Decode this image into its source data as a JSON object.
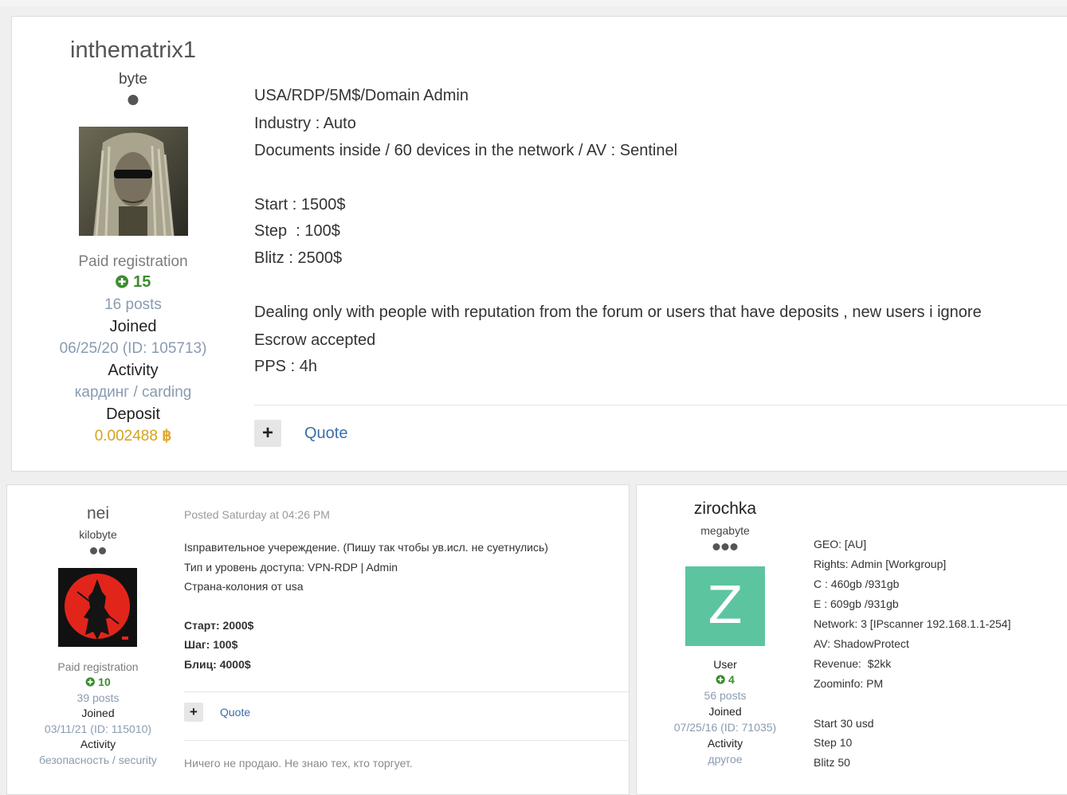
{
  "post1": {
    "author": {
      "username": "inthematrix1",
      "rank": "byte",
      "group": "Paid registration",
      "reputation": "15",
      "posts": "16 posts",
      "joined_label": "Joined",
      "joined_value": "06/25/20 (ID: 105713)",
      "activity_label": "Activity",
      "activity_value": "кардинг / carding",
      "deposit_label": "Deposit",
      "deposit_value": "0.002488"
    },
    "body": [
      "USA/RDP/5M$/Domain Admin",
      "Industry : Auto",
      "Documents inside / 60 devices in the network / AV : Sentinel",
      "Start : 1500$",
      "Step  : 100$",
      "Blitz : 2500$",
      "Dealing only with people with reputation from the forum or users that have deposits , new users i ignore",
      "Escrow accepted",
      "PPS : 4h"
    ],
    "actions": {
      "plus": "+",
      "quote": "Quote"
    }
  },
  "post2": {
    "author": {
      "username": "nei",
      "rank": "kilobyte",
      "group": "Paid registration",
      "reputation": "10",
      "posts": "39 posts",
      "joined_label": "Joined",
      "joined_value": "03/11/21 (ID: 115010)",
      "activity_label": "Activity",
      "activity_value": "безопасность / security"
    },
    "meta": "Posted Saturday at 04:26 PM",
    "body": [
      "Іѕправительное учереждение. (Пишу так чтобы ув.исл. не суетнулись)",
      "Тип и уровень доступа: VPN-RDP | Admin",
      "Страна-колония от usa",
      "Старт: 2000$",
      "Шаг: 100$",
      "Блиц: 4000$"
    ],
    "actions": {
      "plus": "+",
      "quote": "Quote"
    },
    "signature": "Ничего не продаю. Не знаю тех, кто торгует."
  },
  "post3": {
    "author": {
      "username": "zirochka",
      "rank": "megabyte",
      "avatar_letter": "Z",
      "group": "User",
      "reputation": "4",
      "posts": "56 posts",
      "joined_label": "Joined",
      "joined_value": "07/25/16 (ID: 71035)",
      "activity_label": "Activity",
      "activity_value": "другое"
    },
    "body": [
      "GEO: [AU]",
      "Rights: Admin [Workgroup]",
      "C : 460gb /931gb",
      "E : 609gb /931gb",
      "Network: 3 [IPscanner 192.168.1.1-254]",
      "AV: ShadowProtect",
      "Revenue:  $2kk",
      "Zoominfo: PM",
      "Start 30 usd",
      "Step 10",
      "Blitz 50"
    ]
  },
  "colors": {
    "accent_link": "#3b6ea8",
    "reputation_green": "#3c8d2f",
    "deposit_gold": "#d2a31a",
    "avatar_bg": "#5cc5a0"
  },
  "icons": {
    "reputation": "plus-circle-icon",
    "deposit": "bitcoin-icon"
  }
}
